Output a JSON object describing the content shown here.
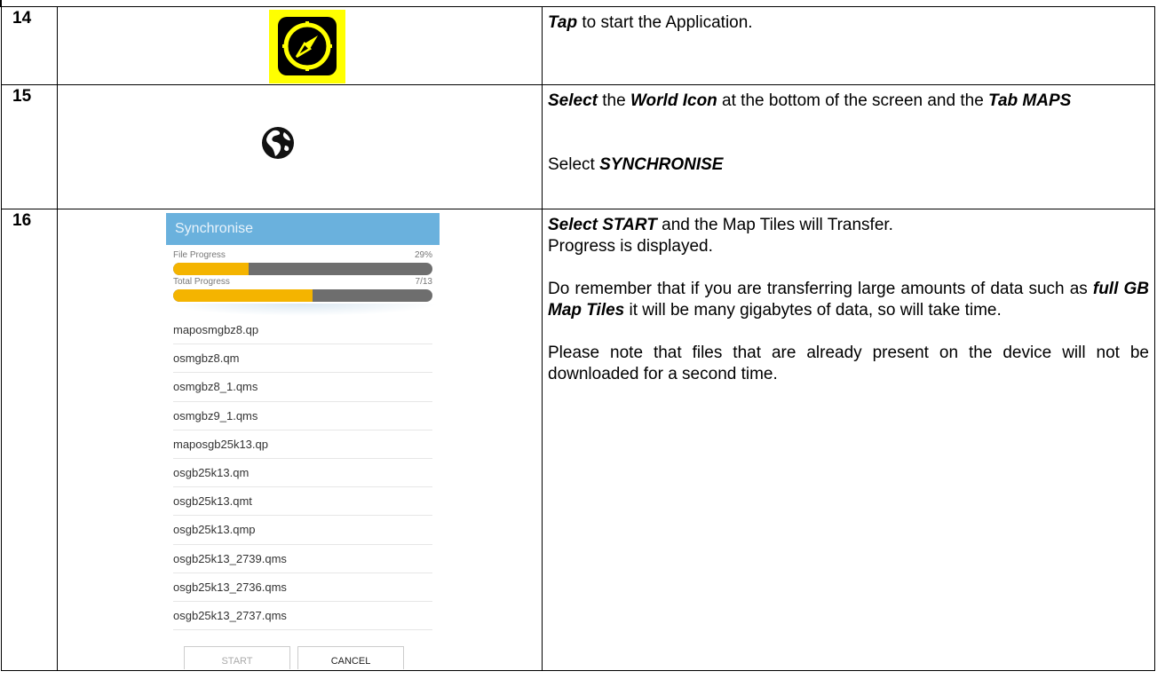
{
  "steps": [
    {
      "number": "14",
      "text": {
        "bold": "Tap",
        "rest": " to start the Application."
      }
    },
    {
      "number": "15",
      "line1": {
        "b1": "Select",
        "t1": " the ",
        "b2": "World Icon",
        "t2": " at the bottom of the screen and the ",
        "b3": "Tab MAPS"
      },
      "line2": {
        "t": "Select ",
        "b": "SYNCHRONISE"
      }
    },
    {
      "number": "16",
      "p1": {
        "b": "Select START",
        "t": " and the Map Tiles will Transfer."
      },
      "p2": "Progress is displayed.",
      "p3": {
        "t1": "Do remember that if you are transferring large amounts of data such as ",
        "b": "full GB Map Tiles",
        "t2": " it will be many gigabytes of data, so will take time."
      },
      "p4": "Please note that files that are already present on the device will not be downloaded for a second time."
    }
  ],
  "phone": {
    "title": "Synchronise",
    "file_progress": {
      "label": "File Progress",
      "value_text": "29%",
      "fraction": 0.29
    },
    "total_progress": {
      "label": "Total Progress",
      "value_text": "7/13",
      "fraction": 0.5385
    },
    "files": [
      "maposmgbz8.qp",
      "osmgbz8.qm",
      "osmgbz8_1.qms",
      "osmgbz9_1.qms",
      "maposgb25k13.qp",
      "osgb25k13.qm",
      "osgb25k13.qmt",
      "osgb25k13.qmp",
      "osgb25k13_2739.qms",
      "osgb25k13_2736.qms",
      "osgb25k13_2737.qms"
    ],
    "start_label": "START",
    "cancel_label": "CANCEL"
  },
  "colors": {
    "accent": "#6ab1dd",
    "progress": "#f4b400",
    "track": "#6e6e6e",
    "compass_bg": "#ffff00"
  },
  "icons": {
    "step14": "compass-icon",
    "step15": "globe-icon"
  }
}
